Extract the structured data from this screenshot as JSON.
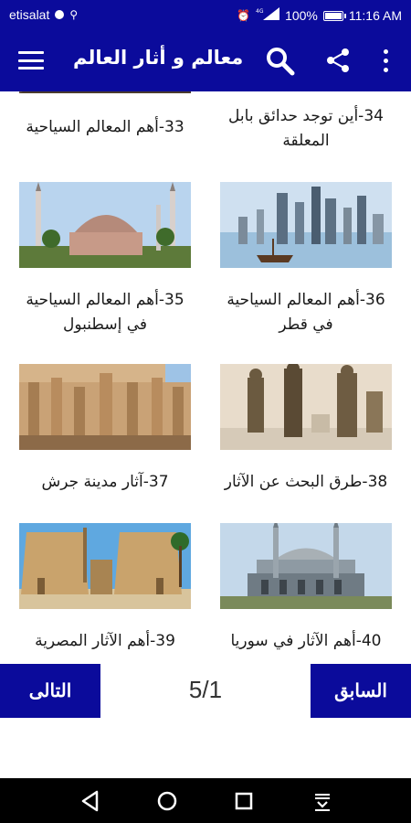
{
  "status_bar": {
    "carrier": "etisalat",
    "battery": "100%",
    "battery_level": 1.0,
    "time": "11:16 AM",
    "signal_label": "4G"
  },
  "app_bar": {
    "title": "معالم و أثار العالم",
    "icons": [
      "menu-icon",
      "search-icon",
      "share-icon",
      "more-vert-icon"
    ]
  },
  "items": [
    {
      "label": "34-أين توجد حدائق بابل المعلقة",
      "image": "partial-top"
    },
    {
      "label": "33-أهم المعالم السياحية",
      "image": "partial-top"
    },
    {
      "label": "36-أهم المعالم السياحية في قطر",
      "image": "doha-skyline"
    },
    {
      "label": "35-أهم المعالم السياحية في إسطنبول",
      "image": "hagia-sophia"
    },
    {
      "label": "38-طرق البحث عن الآثار",
      "image": "museum-statues"
    },
    {
      "label": "37-آثار مدينة جرش",
      "image": "jerash-ruins"
    },
    {
      "label": "40-أهم الآثار في سوريا",
      "image": "mosque-syria"
    },
    {
      "label": "39-أهم الآثار المصرية",
      "image": "luxor-temple"
    }
  ],
  "pager": {
    "prev_label": "السابق",
    "next_label": "التالى",
    "indicator": "5/1"
  },
  "colors": {
    "primary": "#0b0b9b",
    "nav": "#000000",
    "text": "#1a1a1a"
  }
}
